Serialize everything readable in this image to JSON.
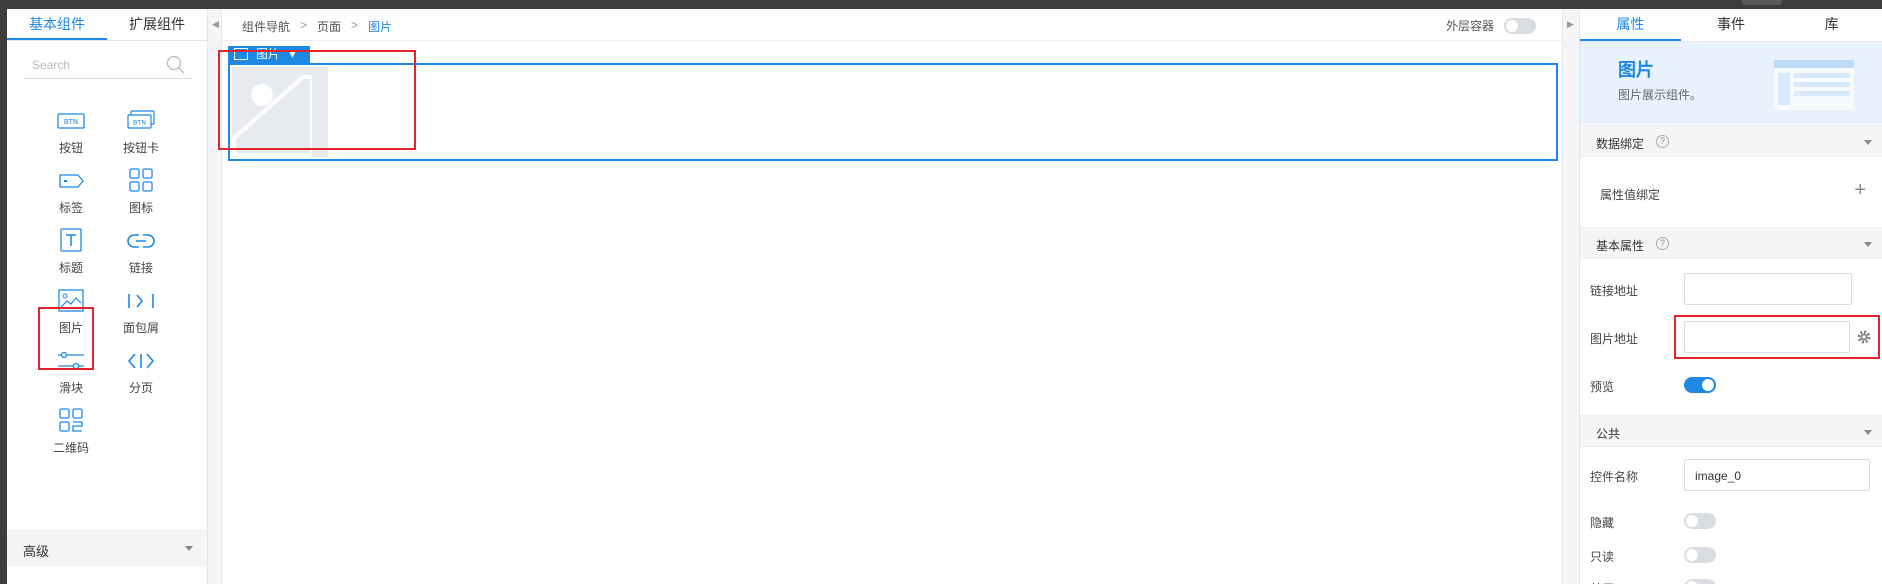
{
  "left_panel": {
    "tabs": [
      "基本组件",
      "扩展组件"
    ],
    "search_placeholder": "Search",
    "components": [
      {
        "label": "按钮",
        "icon": "button-icon"
      },
      {
        "label": "按钮卡",
        "icon": "button-card-icon"
      },
      {
        "label": "标签",
        "icon": "tag-icon"
      },
      {
        "label": "图标",
        "icon": "icon-grid-icon"
      },
      {
        "label": "标题",
        "icon": "title-icon"
      },
      {
        "label": "链接",
        "icon": "link-icon"
      },
      {
        "label": "图片",
        "icon": "image-icon"
      },
      {
        "label": "面包屑",
        "icon": "breadcrumb-icon"
      },
      {
        "label": "滑块",
        "icon": "slider-icon"
      },
      {
        "label": "分页",
        "icon": "pagination-icon"
      },
      {
        "label": "二维码",
        "icon": "qrcode-icon"
      }
    ],
    "advanced_section": "高级",
    "btn_text": "BTN"
  },
  "breadcrumb": [
    "组件导航",
    "页面",
    "图片"
  ],
  "outer_container": {
    "label": "外层容器",
    "on": false
  },
  "canvas": {
    "selected_tag": "图片"
  },
  "right_panel": {
    "tabs": [
      "属性",
      "事件",
      "库"
    ],
    "hero": {
      "title": "图片",
      "subtitle": "图片展示组件。"
    },
    "data_binding": {
      "title": "数据绑定",
      "row_label": "属性值绑定"
    },
    "basic_props": {
      "title": "基本属性",
      "link_label": "链接地址",
      "link_value": "",
      "image_label": "图片地址",
      "image_value": "",
      "preview_label": "预览",
      "preview_on": true
    },
    "common": {
      "title": "公共",
      "name_label": "控件名称",
      "name_value": "image_0",
      "hidden_label": "隐藏",
      "readonly_label": "只读",
      "disabled_label": "禁用"
    },
    "help_glyph": "?"
  },
  "colors": {
    "accent": "#1e88e5",
    "highlight": "#e3242b"
  }
}
